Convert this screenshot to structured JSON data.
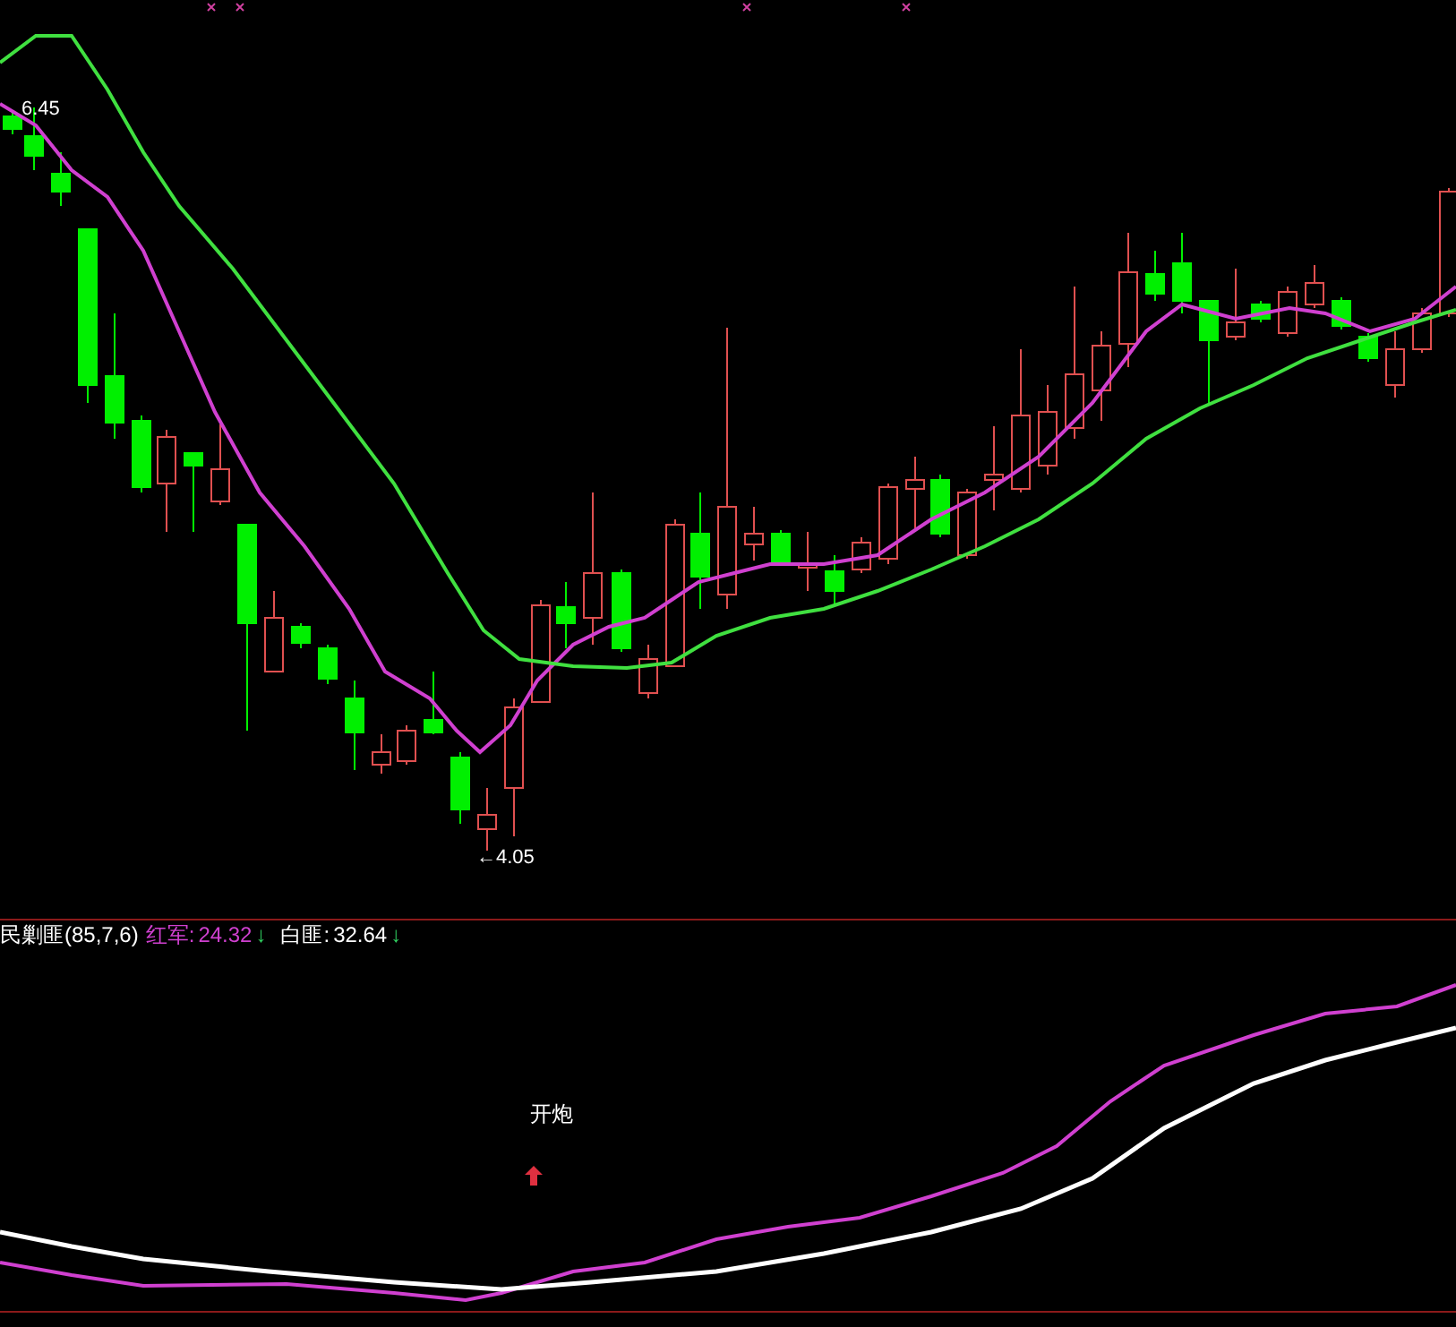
{
  "price_pane": {
    "high_label": "6.45",
    "low_label": "←4.05"
  },
  "indicator_pane": {
    "title": "民剿匪(85,7,6)",
    "readings": [
      {
        "label": "红军:",
        "value": "24.32",
        "arrow": "↓",
        "color": "#d040d0"
      },
      {
        "label": "白匪:",
        "value": "32.64",
        "arrow": "↓",
        "color": "#ffffff"
      }
    ],
    "signal": {
      "label": "开炮"
    }
  }
}
